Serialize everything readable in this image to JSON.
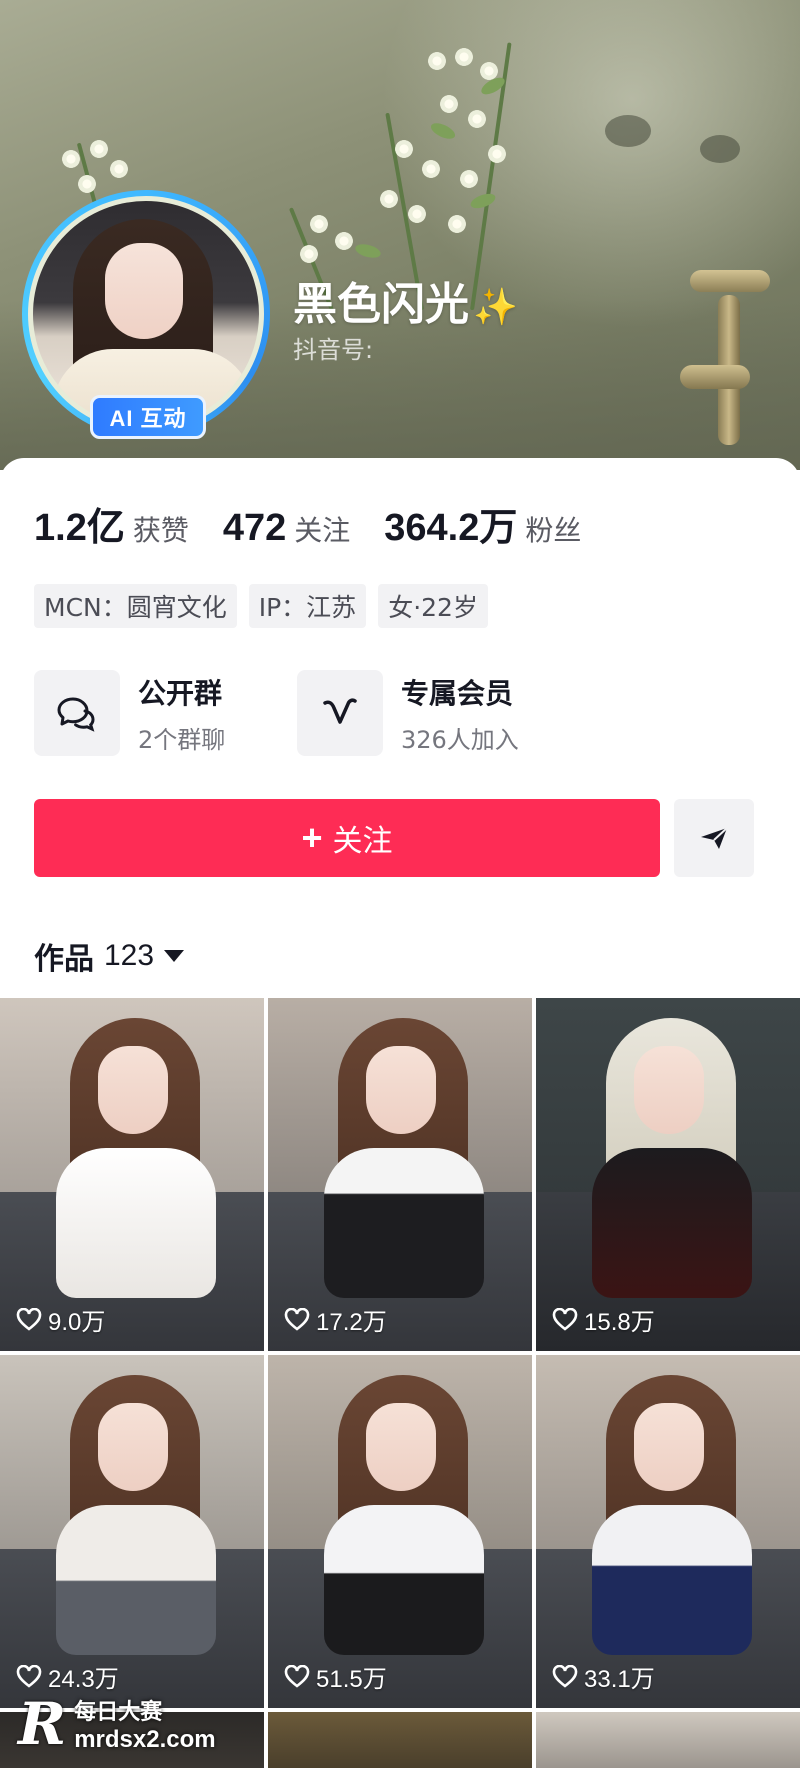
{
  "profile": {
    "nickname": "黑色闪光",
    "sparkle": "✨",
    "douyin_id_label": "抖音号:",
    "ai_badge": "AI 互动"
  },
  "stats": [
    {
      "value": "1.2亿",
      "label": "获赞"
    },
    {
      "value": "472",
      "label": "关注"
    },
    {
      "value": "364.2万",
      "label": "粉丝"
    }
  ],
  "tags": [
    "MCN：圆宵文化",
    "IP：江苏",
    "女·22岁"
  ],
  "entries": [
    {
      "title": "公开群",
      "subtitle": "2个群聊",
      "icon": "chat-bubbles-icon"
    },
    {
      "title": "专属会员",
      "subtitle": "326人加入",
      "icon": "vip-v-icon"
    }
  ],
  "actions": {
    "follow_label": "关注",
    "share_icon": "send-arrow-icon"
  },
  "works": {
    "label": "作品",
    "count": "123"
  },
  "grid": [
    {
      "likes": "9.0万"
    },
    {
      "likes": "17.2万"
    },
    {
      "likes": "15.8万"
    },
    {
      "likes": "24.3万"
    },
    {
      "likes": "51.5万"
    },
    {
      "likes": "33.1万"
    }
  ],
  "watermark": {
    "logo": "R",
    "line1": "每日大赛",
    "line2": "mrdsx2.com"
  },
  "colors": {
    "accent": "#fe2c55",
    "ai_badge": "#2f7bff"
  }
}
